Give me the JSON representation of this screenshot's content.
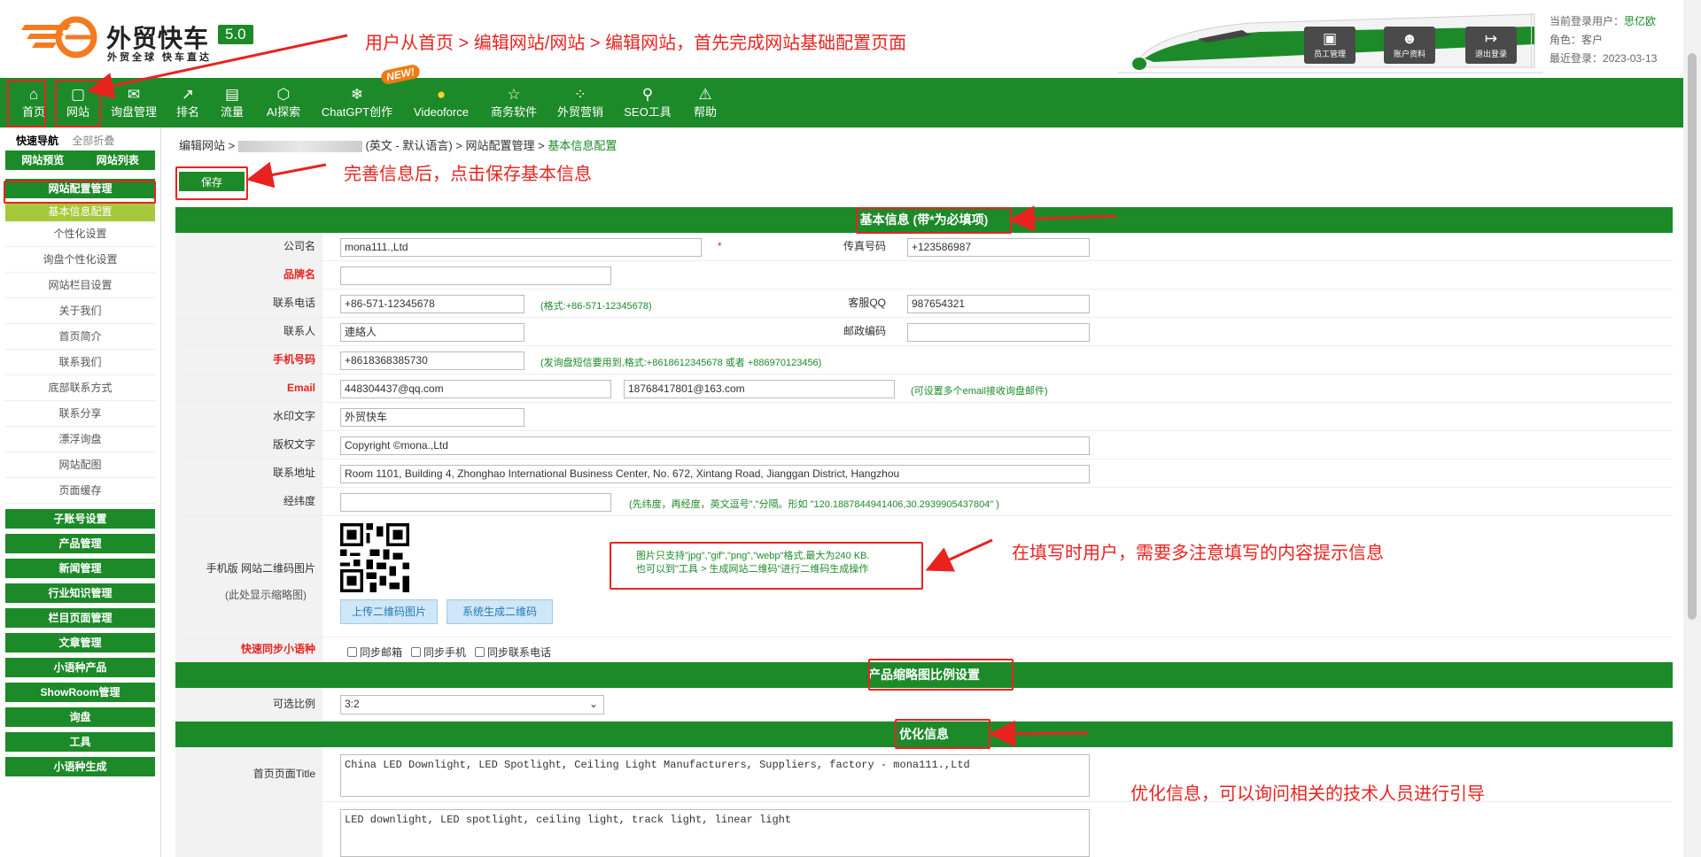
{
  "header": {
    "logo_name": "外贸快车",
    "logo_version": "5.0",
    "logo_slogan": "外贸全球 快车直达",
    "tools": [
      {
        "icon": "staff-icon",
        "label": "员工管理"
      },
      {
        "icon": "account-icon",
        "label": "账户资料"
      },
      {
        "icon": "logout-icon",
        "label": "退出登录"
      }
    ],
    "user": {
      "current_label": "当前登录用户：",
      "current_value": "思亿欧",
      "role_label": "角色：",
      "role_value": "客户",
      "last_login_label": "最近登录：",
      "last_login_value": "2023-03-13"
    }
  },
  "nav": {
    "items": [
      {
        "icon": "home-icon",
        "label": "首页"
      },
      {
        "icon": "website-icon",
        "label": "网站"
      },
      {
        "icon": "mail-icon",
        "label": "询盘管理"
      },
      {
        "icon": "ranking-icon",
        "label": "排名"
      },
      {
        "icon": "traffic-icon",
        "label": "流量"
      },
      {
        "icon": "ai-search-icon",
        "label": "AI探索"
      },
      {
        "icon": "chatgpt-icon",
        "label": "ChatGPT创作"
      },
      {
        "icon": "videoforce-icon",
        "label": "Videoforce"
      },
      {
        "icon": "business-icon",
        "label": "商务软件"
      },
      {
        "icon": "marketing-icon",
        "label": "外贸营销"
      },
      {
        "icon": "seo-icon",
        "label": "SEO工具"
      },
      {
        "icon": "help-icon",
        "label": "帮助"
      }
    ],
    "new_badge": "NEW!"
  },
  "sidebar": {
    "quick_nav": "快速导航",
    "collapse_all": "全部折叠",
    "preview": "网站预览",
    "site_list": "网站列表",
    "config_group": "网站配置管理",
    "active_item": "基本信息配置",
    "sub_items": [
      "个性化设置",
      "询盘个性化设置",
      "网站栏目设置",
      "关于我们",
      "首页简介",
      "联系我们",
      "底部联系方式",
      "联系分享",
      "漂浮询盘",
      "网站配图",
      "页面缓存"
    ],
    "groups": [
      "子账号设置",
      "产品管理",
      "新闻管理",
      "行业知识管理",
      "栏目页面管理",
      "文章管理",
      "小语种产品",
      "ShowRoom管理",
      "询盘",
      "工具",
      "小语种生成"
    ]
  },
  "main": {
    "breadcrumb": {
      "prefix": "编辑网站 >",
      "lang": "(英文 - 默认语言) >",
      "config": "网站配置管理 >",
      "current": "基本信息配置"
    },
    "save_label": "保存",
    "section_basic": "基本信息 (带*为必填项)",
    "section_thumb": "产品缩略图比例设置",
    "section_seo": "优化信息",
    "fields": {
      "company_label": "公司名",
      "company_value": "mona111.,Ltd",
      "required_star": "*",
      "fax_label": "传真号码",
      "fax_value": "+123586987",
      "brand_label": "品牌名",
      "brand_value": "",
      "phone_label": "联系电话",
      "phone_value": "+86-571-12345678",
      "phone_hint": "(格式:+86-571-12345678)",
      "qq_label": "客服QQ",
      "qq_value": "987654321",
      "contact_label": "联系人",
      "contact_value": "連絡人",
      "postcode_label": "邮政编码",
      "postcode_value": "",
      "mobile_label": "手机号码",
      "mobile_value": "+8618368385730",
      "mobile_hint": "(发询盘短信要用到,格式:+8618612345678 或者 +886970123456)",
      "email_label": "Email",
      "email_value": "448304437@qq.com",
      "email2_value": "18768417801@163.com",
      "email_hint": "(可设置多个email接收询盘邮件)",
      "watermark_label": "水印文字",
      "watermark_value": "外贸快车",
      "copyright_label": "版权文字",
      "copyright_value": "Copyright ©mona.,Ltd",
      "address_label": "联系地址",
      "address_value": "Room 1101, Building 4, Zhonghao International Business Center, No. 672, Xintang Road, Jianggan District, Hangzhou",
      "latlng_label": "经纬度",
      "latlng_value": "",
      "latlng_hint": "(先纬度，再经度，英文逗号\",\"分隔。形如 \"120.1887844941406,30.2939905437804\" )",
      "qr_label": "手机版 网站二维码图片",
      "qr_sub": "(此处显示缩略图)",
      "qr_upload": "上传二维码图片",
      "qr_generate": "系统生成二维码",
      "qr_note_1": "图片只支持\"jpg\",\"gif\",\"png\",\"webp\"格式,最大为240 KB.",
      "qr_note_2": "也可以到\"工具 > 生成网站二维码\"进行二维码生成操作",
      "sync_label": "快速同步小语种",
      "sync_email": "同步邮箱",
      "sync_mobile": "同步手机",
      "sync_phone": "同步联系电话",
      "ratio_label": "可选比例",
      "ratio_value": "3:2",
      "title_label": "首页页面Title",
      "title_value": "China LED Downlight, LED Spotlight, Ceiling Light Manufacturers, Suppliers, factory - mona111.,Ltd",
      "keywords_value": "LED downlight, LED spotlight, ceiling light, track light, linear light"
    }
  },
  "annotations": {
    "top": "用户从首页 > 编辑网站/网站 > 编辑网站，首先完成网站基础配置页面",
    "save": "完善信息后，点击保存基本信息",
    "hint": "在填写时用户，需要多注意填写的内容提示信息",
    "seo": "优化信息，可以询问相关的技术人员进行引导"
  },
  "colors": {
    "brand_green": "#1c8a28",
    "annotation_red": "#e8231f",
    "active_sub": "#a6c93c"
  }
}
